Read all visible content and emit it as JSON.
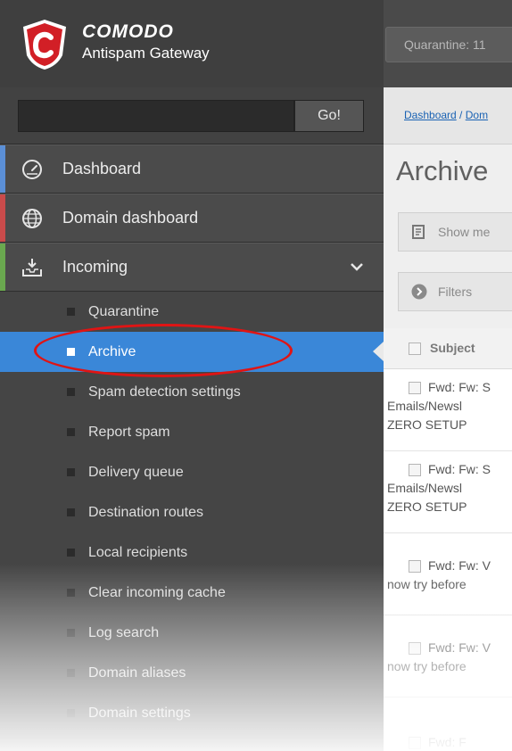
{
  "brand": {
    "name": "COMODO",
    "product": "Antispam Gateway"
  },
  "header": {
    "quarantine_label": "Quarantine: 11"
  },
  "search": {
    "value": "",
    "button_label": "Go!"
  },
  "sidebar": {
    "main": [
      {
        "label": "Dashboard",
        "icon": "speedometer-icon",
        "accent": "#5b8fd6"
      },
      {
        "label": "Domain dashboard",
        "icon": "globe-icon",
        "accent": "#c94b4b"
      },
      {
        "label": "Incoming",
        "icon": "inbox-download-icon",
        "accent": "#6aa84f"
      }
    ],
    "incoming_items": [
      {
        "label": "Quarantine"
      },
      {
        "label": "Archive",
        "active": true
      },
      {
        "label": "Spam detection settings"
      },
      {
        "label": "Report spam"
      },
      {
        "label": "Delivery queue"
      },
      {
        "label": "Destination routes"
      },
      {
        "label": "Local recipients"
      },
      {
        "label": "Clear incoming cache"
      },
      {
        "label": "Log search"
      },
      {
        "label": "Domain aliases"
      },
      {
        "label": "Domain settings"
      }
    ]
  },
  "content": {
    "breadcrumb": {
      "home": "Dashboard",
      "sep": " / ",
      "next": "Dom"
    },
    "title": "Archive",
    "show_button": "Show me",
    "filters_button": "Filters",
    "table": {
      "header": "Subject",
      "rows": [
        {
          "line1": "Fwd: Fw: S",
          "line2": "Emails/Newsl",
          "line3": "ZERO SETUP"
        },
        {
          "line1": "Fwd: Fw: S",
          "line2": "Emails/Newsl",
          "line3": "ZERO SETUP"
        },
        {
          "line1": "Fwd: Fw: V",
          "line2": "now try before",
          "line3": ""
        },
        {
          "line1": "Fwd: Fw: V",
          "line2": "now try before",
          "line3": ""
        },
        {
          "line1": "Fwd: F",
          "line2": "",
          "line3": ""
        }
      ]
    }
  },
  "colors": {
    "active_item": "#3a87d8",
    "highlight_ring": "#e01414",
    "sidebar_bg": "#3d3d3d"
  }
}
